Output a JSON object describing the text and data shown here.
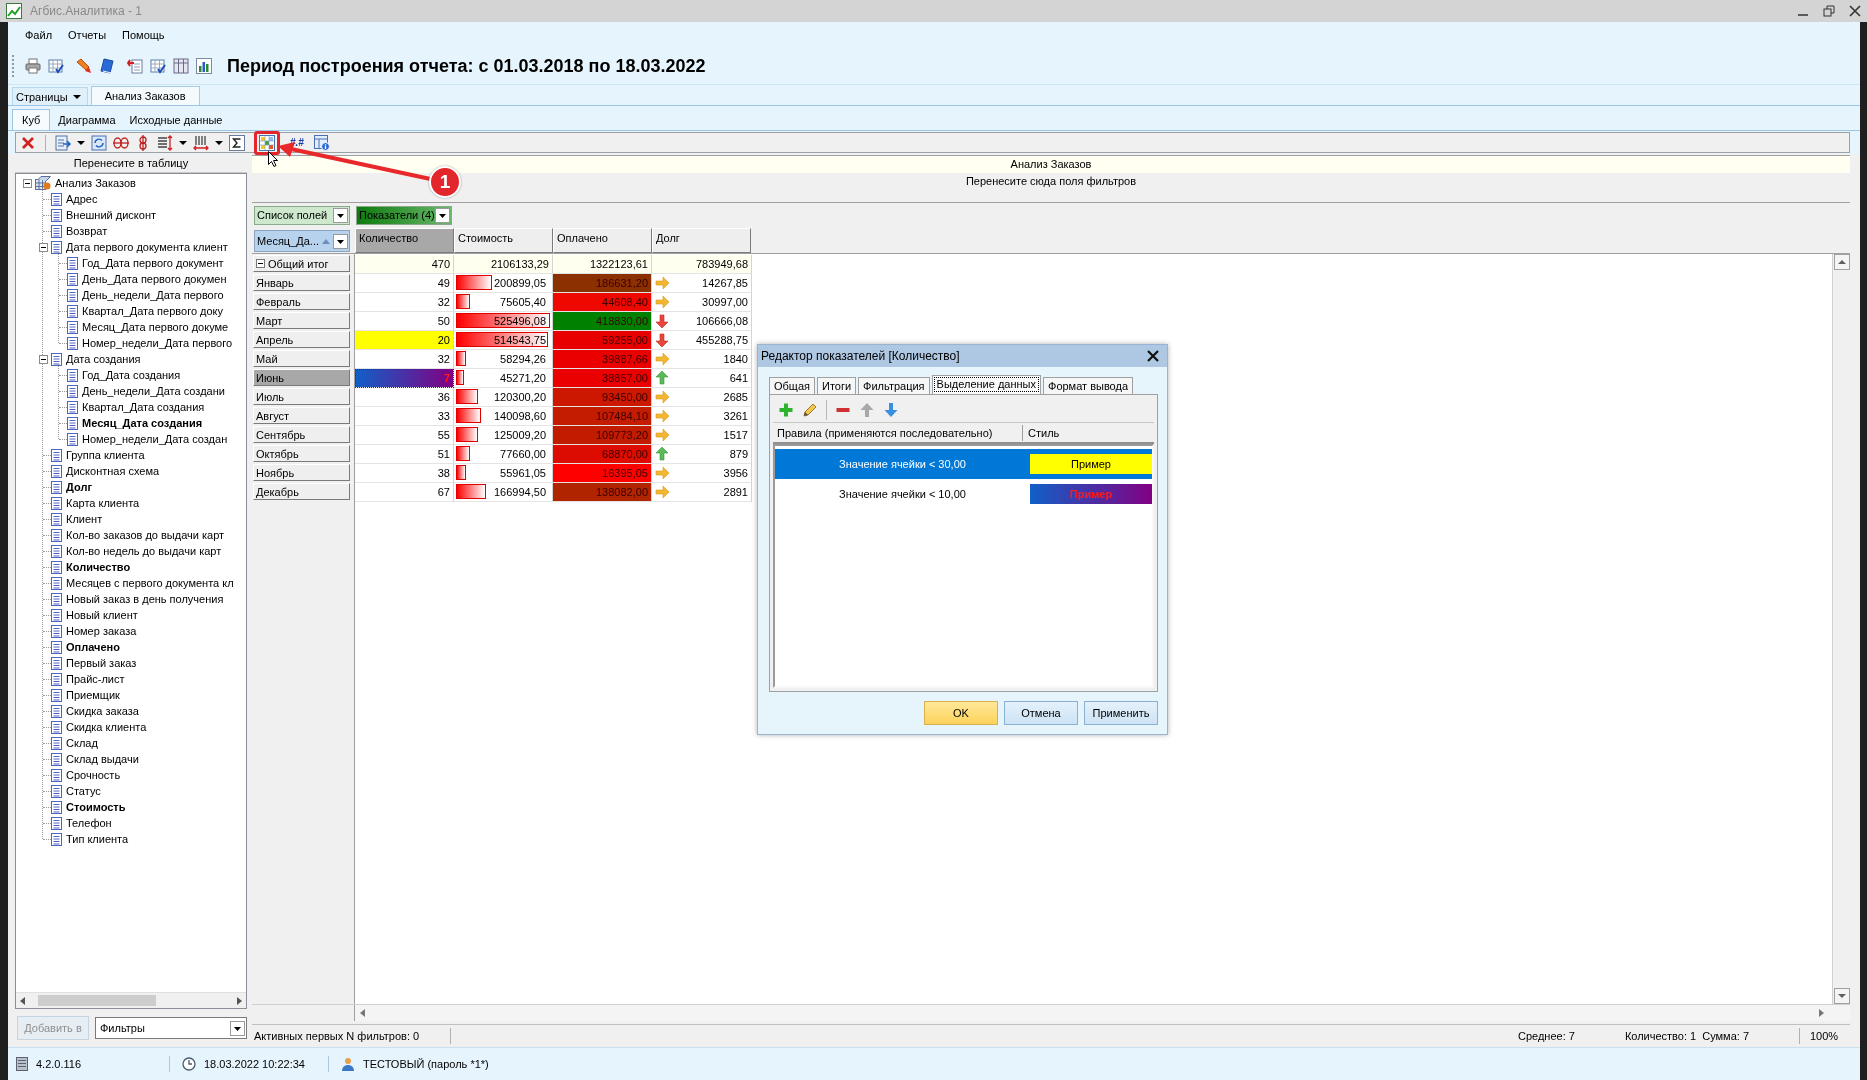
{
  "window": {
    "title": "Агбис.Аналитика - 1"
  },
  "menu": [
    "Файл",
    "Отчеты",
    "Помощь"
  ],
  "report_title": "Период построения отчета: с 01.03.2018 по 18.03.2022",
  "pages": {
    "menu_label": "Страницы",
    "tabs": [
      {
        "label": "Анализ Заказов",
        "selected": true
      }
    ]
  },
  "view_tabs": [
    {
      "label": "Куб",
      "selected": true
    },
    {
      "label": "Диаграмма",
      "selected": false
    },
    {
      "label": "Исходные данные",
      "selected": false
    }
  ],
  "cube_toolbar": {
    "number_format": "#.#"
  },
  "annotation": {
    "badge": "1"
  },
  "field_panel": {
    "header": "Перенесите в таблицу",
    "tree": {
      "label": "Анализ Заказов",
      "in_use": false,
      "expanded": true,
      "children": [
        {
          "label": "Адрес",
          "in_use": false
        },
        {
          "label": "Внешний дисконт",
          "in_use": false
        },
        {
          "label": "Возврат",
          "in_use": false
        },
        {
          "label": "Дата первого документа клиент",
          "in_use": false,
          "expanded": true,
          "children": [
            {
              "label": "Год_Дата первого документ",
              "in_use": false
            },
            {
              "label": "День_Дата первого докумен",
              "in_use": false
            },
            {
              "label": "День_недели_Дата первого",
              "in_use": false
            },
            {
              "label": "Квартал_Дата первого доку",
              "in_use": false
            },
            {
              "label": "Месяц_Дата первого докуме",
              "in_use": false
            },
            {
              "label": "Номер_недели_Дата первого",
              "in_use": false
            }
          ]
        },
        {
          "label": "Дата создания",
          "in_use": false,
          "expanded": true,
          "children": [
            {
              "label": "Год_Дата создания",
              "in_use": false
            },
            {
              "label": "День_недели_Дата создани",
              "in_use": false
            },
            {
              "label": "Квартал_Дата создания",
              "in_use": false
            },
            {
              "label": "Месяц_Дата создания",
              "in_use": true
            },
            {
              "label": "Номер_недели_Дата создан",
              "in_use": false
            }
          ]
        },
        {
          "label": "Группа клиента",
          "in_use": false
        },
        {
          "label": "Дисконтная схема",
          "in_use": false
        },
        {
          "label": "Долг",
          "in_use": true
        },
        {
          "label": "Карта клиента",
          "in_use": false
        },
        {
          "label": "Клиент",
          "in_use": false
        },
        {
          "label": "Кол-во заказов до выдачи карт",
          "in_use": false
        },
        {
          "label": "Кол-во недель до выдачи карт",
          "in_use": false
        },
        {
          "label": "Количество",
          "in_use": true
        },
        {
          "label": "Месяцев с первого документа кл",
          "in_use": false
        },
        {
          "label": "Новый заказ в день получения",
          "in_use": false
        },
        {
          "label": "Новый клиент",
          "in_use": false
        },
        {
          "label": "Номер заказа",
          "in_use": false
        },
        {
          "label": "Оплачено",
          "in_use": true
        },
        {
          "label": "Первый заказ",
          "in_use": false
        },
        {
          "label": "Прайс-лист",
          "in_use": false
        },
        {
          "label": "Приемщик",
          "in_use": false
        },
        {
          "label": "Скидка заказа",
          "in_use": false
        },
        {
          "label": "Скидка клиента",
          "in_use": false
        },
        {
          "label": "Склад",
          "in_use": false
        },
        {
          "label": "Склад выдачи",
          "in_use": false
        },
        {
          "label": "Срочность",
          "in_use": false
        },
        {
          "label": "Статус",
          "in_use": false
        },
        {
          "label": "Стоимость",
          "in_use": true
        },
        {
          "label": "Телефон",
          "in_use": false
        },
        {
          "label": "Тип клиента",
          "in_use": false
        }
      ]
    },
    "add_button": {
      "label": "Добавить в",
      "disabled": true
    },
    "target": {
      "value": "Фильтры"
    }
  },
  "pivot": {
    "title": "Анализ Заказов",
    "filter_hint": "Перенесите сюда поля фильтров",
    "field_list": "Список полей",
    "measures": "Показатели (4)",
    "row_field": {
      "label": "Месяц_Да...",
      "sort_ascending": true
    },
    "columns": [
      {
        "label": "Количество",
        "selected": true
      },
      {
        "label": "Стоимость",
        "selected": false
      },
      {
        "label": "Оплачено",
        "selected": false
      },
      {
        "label": "Долг",
        "selected": false
      }
    ],
    "total": {
      "label": "Общий итог",
      "expanded": true,
      "values": [
        "470",
        "2106133,29",
        "1322123,61",
        "783949,68"
      ]
    },
    "rows": [
      {
        "label": "Январь",
        "selected": false,
        "cells": [
          {
            "kind": "plain",
            "value": "49"
          },
          {
            "kind": "bar",
            "value": "200899,05",
            "level": 0.382
          },
          {
            "kind": "scale",
            "value": "186631,20",
            "color": "#8b3000"
          },
          {
            "kind": "arrow_right",
            "value": "14267,85"
          }
        ]
      },
      {
        "label": "Февраль",
        "selected": false,
        "cells": [
          {
            "kind": "plain",
            "value": "32"
          },
          {
            "kind": "bar",
            "value": "75605,40",
            "level": 0.144
          },
          {
            "kind": "scale",
            "value": "44608,40",
            "color": "#ee0800"
          },
          {
            "kind": "arrow_right",
            "value": "30997,00"
          }
        ]
      },
      {
        "label": "Март",
        "selected": false,
        "cells": [
          {
            "kind": "plain",
            "value": "50"
          },
          {
            "kind": "bar",
            "value": "525496,08",
            "level": 1
          },
          {
            "kind": "scale",
            "value": "418830,00",
            "color": "#008000"
          },
          {
            "kind": "arrow_down",
            "value": "106666,08"
          }
        ]
      },
      {
        "label": "Апрель",
        "selected": false,
        "cells": [
          {
            "kind": "fill",
            "value": "20"
          },
          {
            "kind": "bar",
            "value": "514543,75",
            "level": 0.979
          },
          {
            "kind": "scale",
            "value": "59255,00",
            "color": "#e80000"
          },
          {
            "kind": "arrow_down",
            "value": "455288,75"
          }
        ]
      },
      {
        "label": "Май",
        "selected": false,
        "cells": [
          {
            "kind": "plain",
            "value": "32"
          },
          {
            "kind": "bar",
            "value": "58294,26",
            "level": 0.111
          },
          {
            "kind": "scale",
            "value": "39887,66",
            "color": "#ea0000"
          },
          {
            "kind": "arrow_right",
            "value": "1840"
          }
        ]
      },
      {
        "label": "Июнь",
        "selected": true,
        "cells": [
          {
            "kind": "gradient",
            "value": "7"
          },
          {
            "kind": "bar",
            "value": "45271,20",
            "level": 0.086
          },
          {
            "kind": "scale",
            "value": "38857,00",
            "color": "#ea0000"
          },
          {
            "kind": "arrow_up",
            "value": "641"
          }
        ]
      },
      {
        "label": "Июль",
        "selected": false,
        "cells": [
          {
            "kind": "plain",
            "value": "36"
          },
          {
            "kind": "bar",
            "value": "120300,20",
            "level": 0.229
          },
          {
            "kind": "scale",
            "value": "93450,00",
            "color": "#cc1800"
          },
          {
            "kind": "arrow_right",
            "value": "2685"
          }
        ]
      },
      {
        "label": "Август",
        "selected": false,
        "cells": [
          {
            "kind": "plain",
            "value": "33"
          },
          {
            "kind": "bar",
            "value": "140098,60",
            "level": 0.267
          },
          {
            "kind": "scale",
            "value": "107484,10",
            "color": "#c41c00"
          },
          {
            "kind": "arrow_right",
            "value": "3261"
          }
        ]
      },
      {
        "label": "Сентябрь",
        "selected": false,
        "cells": [
          {
            "kind": "plain",
            "value": "55"
          },
          {
            "kind": "bar",
            "value": "125009,20",
            "level": 0.238
          },
          {
            "kind": "scale",
            "value": "109773,20",
            "color": "#c21c00"
          },
          {
            "kind": "arrow_right",
            "value": "1517"
          }
        ]
      },
      {
        "label": "Октябрь",
        "selected": false,
        "cells": [
          {
            "kind": "plain",
            "value": "51"
          },
          {
            "kind": "bar",
            "value": "77660,00",
            "level": 0.148
          },
          {
            "kind": "scale",
            "value": "68870,00",
            "color": "#dc0c00"
          },
          {
            "kind": "arrow_up",
            "value": "879"
          }
        ]
      },
      {
        "label": "Ноябрь",
        "selected": false,
        "cells": [
          {
            "kind": "plain",
            "value": "38"
          },
          {
            "kind": "bar",
            "value": "55961,05",
            "level": 0.106
          },
          {
            "kind": "scale",
            "value": "16395,05",
            "color": "#ff0000"
          },
          {
            "kind": "arrow_right",
            "value": "3956"
          }
        ]
      },
      {
        "label": "Декабрь",
        "selected": false,
        "cells": [
          {
            "kind": "plain",
            "value": "67"
          },
          {
            "kind": "bar",
            "value": "166994,50",
            "level": 0.318
          },
          {
            "kind": "scale",
            "value": "138082,00",
            "color": "#b02400"
          },
          {
            "kind": "arrow_right",
            "value": "2891"
          }
        ]
      }
    ]
  },
  "pivot_status": {
    "filters": "Активных первых N фильтров: 0",
    "average": "Среднее: 7",
    "count": "Количество: 1",
    "sum": "Сумма: 7",
    "zoom": "100%"
  },
  "dialog": {
    "title": "Редактор показателей [Количество]",
    "tabs": [
      {
        "label": "Общая",
        "selected": false
      },
      {
        "label": "Итоги",
        "selected": false
      },
      {
        "label": "Фильтрация",
        "selected": false
      },
      {
        "label": "Выделение данных",
        "selected": true
      },
      {
        "label": "Формат вывода",
        "selected": false
      }
    ],
    "tools": [
      {
        "kind": "add",
        "disabled": false
      },
      {
        "kind": "edit",
        "disabled": false
      },
      {
        "kind": "remove",
        "disabled": false
      },
      {
        "kind": "up",
        "disabled": true
      },
      {
        "kind": "down",
        "disabled": false
      }
    ],
    "columns": [
      "Правила (применяются последовательно)",
      "Стиль"
    ],
    "rules": [
      {
        "kind": "fill",
        "condition": "Значение ячейки < 30,00",
        "sample": "Пример",
        "selected": true
      },
      {
        "kind": "gradient",
        "condition": "Значение ячейки < 10,00",
        "sample": "Пример",
        "selected": false
      }
    ],
    "buttons": [
      {
        "label": "OK",
        "kind": "default"
      },
      {
        "label": "Отмена",
        "kind": "normal"
      },
      {
        "label": "Применить",
        "kind": "normal"
      }
    ]
  },
  "status_bar": {
    "version": "4.2.0.116",
    "datetime": "18.03.2022 10:22:34",
    "user": "ТЕСТОВЫЙ (пароль *1*)"
  }
}
